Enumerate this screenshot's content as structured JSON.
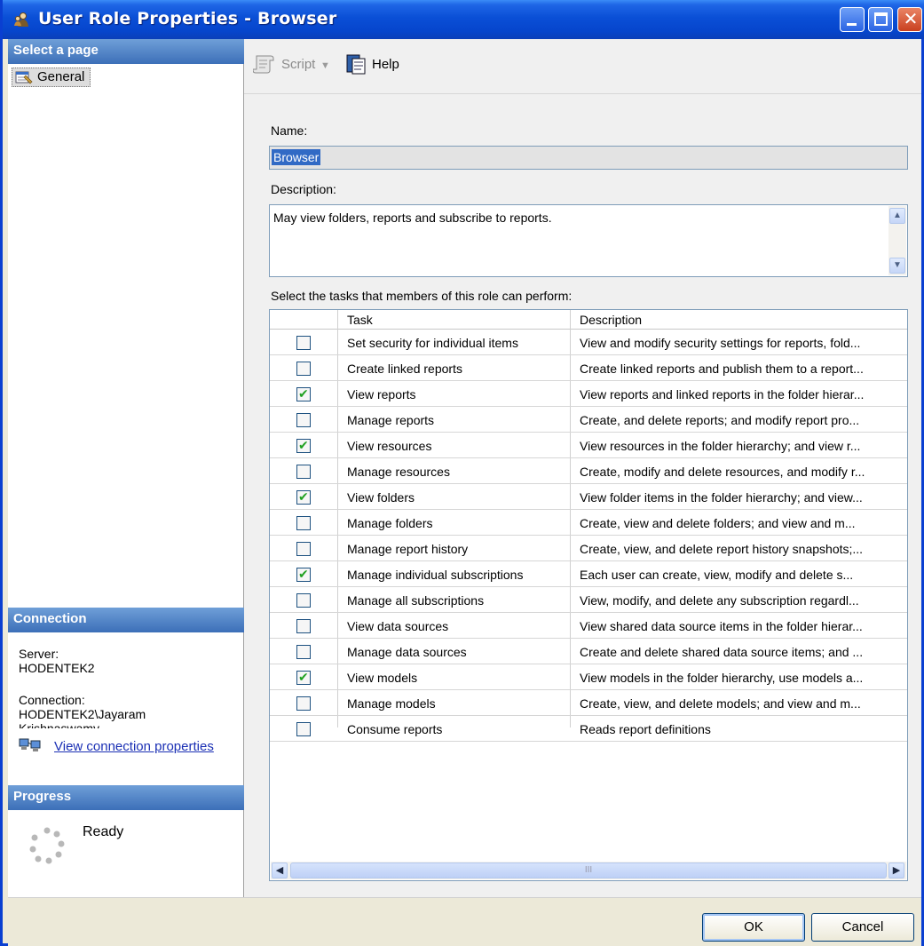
{
  "window": {
    "title": "User Role Properties - Browser"
  },
  "left": {
    "select_page_header": "Select a page",
    "pages": [
      {
        "label": "General"
      }
    ],
    "connection_header": "Connection",
    "server_label": "Server:",
    "server_value": "HODENTEK2",
    "connection_label": "Connection:",
    "connection_value": "HODENTEK2\\Jayaram",
    "connection_value_cont": "Krishnaswamy",
    "view_connection_link": "View connection properties",
    "progress_header": "Progress",
    "progress_status": "Ready"
  },
  "toolbar": {
    "script_label": "Script",
    "help_label": "Help"
  },
  "form": {
    "name_label": "Name:",
    "name_value": "Browser",
    "description_label": "Description:",
    "description_value": "May view folders, reports and subscribe to reports.",
    "tasks_label": "Select the tasks that members of this role can perform:"
  },
  "grid": {
    "columns": [
      "Task",
      "Description"
    ],
    "rows": [
      {
        "checked": false,
        "task": "Set security for individual items",
        "description": "View and modify security settings for reports, fold..."
      },
      {
        "checked": false,
        "task": "Create linked reports",
        "description": "Create linked reports and publish them to a report..."
      },
      {
        "checked": true,
        "task": "View reports",
        "description": "View reports and linked reports in the folder hierar..."
      },
      {
        "checked": false,
        "task": "Manage reports",
        "description": "Create, and delete reports; and modify report pro..."
      },
      {
        "checked": true,
        "task": "View resources",
        "description": "View resources in the folder hierarchy; and view r..."
      },
      {
        "checked": false,
        "task": "Manage resources",
        "description": "Create, modify and delete resources, and modify r..."
      },
      {
        "checked": true,
        "task": "View folders",
        "description": "View folder items in the folder hierarchy; and view..."
      },
      {
        "checked": false,
        "task": "Manage folders",
        "description": "Create, view and delete folders; and view and m..."
      },
      {
        "checked": false,
        "task": "Manage report history",
        "description": "Create, view, and delete report history snapshots;..."
      },
      {
        "checked": true,
        "task": "Manage individual subscriptions",
        "description": "Each user can create, view, modify and delete s..."
      },
      {
        "checked": false,
        "task": "Manage all subscriptions",
        "description": "View, modify, and delete any subscription regardl..."
      },
      {
        "checked": false,
        "task": "View data sources",
        "description": "View shared data source items in the folder hierar..."
      },
      {
        "checked": false,
        "task": "Manage data sources",
        "description": "Create and delete shared data source items; and ..."
      },
      {
        "checked": true,
        "task": "View models",
        "description": "View models in the folder hierarchy, use models a..."
      },
      {
        "checked": false,
        "task": "Manage models",
        "description": "Create, view, and delete models; and view and m..."
      },
      {
        "checked": false,
        "task": "Consume reports",
        "description": "Reads report definitions"
      }
    ],
    "hscroll_thumb_glyph": "III"
  },
  "buttons": {
    "ok": "OK",
    "cancel": "Cancel"
  }
}
